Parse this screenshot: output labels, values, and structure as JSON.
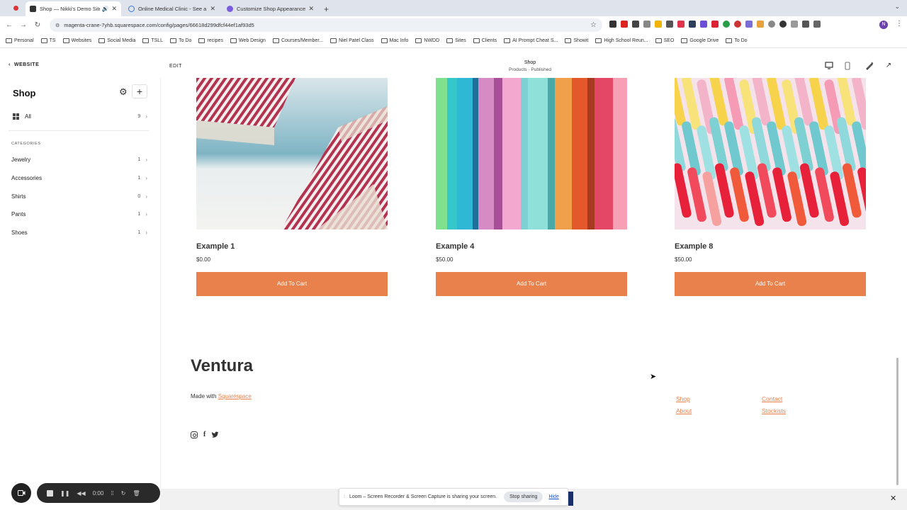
{
  "browser": {
    "tabs": [
      {
        "title": "Shop — Nikki's Demo Site",
        "active": true
      },
      {
        "title": "Online Medical Clinic - See a",
        "active": false
      },
      {
        "title": "Customize Shop Appearance",
        "active": false
      }
    ],
    "url": "magenta-crane-7yhb.squarespace.com/config/pages/66618d299dfcf44ef1af93d5",
    "profile_initial": "N",
    "bookmarks": [
      "Personal",
      "TS",
      "Websites",
      "Social Media",
      "TSLL",
      "To Do",
      "recipes",
      "Web Design",
      "Courses/Member...",
      "Niel Patel Class",
      "Mac Info",
      "NWDD",
      "Sites",
      "Clients",
      "AI Prompt Cheat S...",
      "Showit",
      "High School Reun...",
      "SEO",
      "Google Drive",
      "To Do"
    ]
  },
  "sidebar": {
    "back_label": "WEBSITE",
    "title": "Shop",
    "all": {
      "label": "All",
      "count": "9"
    },
    "categories_heading": "CATEGORIES",
    "categories": [
      {
        "label": "Jewelry",
        "count": "1"
      },
      {
        "label": "Accessories",
        "count": "1"
      },
      {
        "label": "Shirts",
        "count": "0"
      },
      {
        "label": "Pants",
        "count": "1"
      },
      {
        "label": "Shoes",
        "count": "1"
      }
    ]
  },
  "editor": {
    "edit_label": "EDIT",
    "page_name": "Shop",
    "page_status": "Products · Published"
  },
  "products": [
    {
      "name": "Example 1",
      "price": "$0.00",
      "button": "Add To Cart"
    },
    {
      "name": "Example 4",
      "price": "$50.00",
      "button": "Add To Cart"
    },
    {
      "name": "Example 8",
      "price": "$50.00",
      "button": "Add To Cart"
    }
  ],
  "footer": {
    "brand": "Ventura",
    "made_with": "Made with ",
    "made_link": "Squarespace",
    "links_col1": [
      "Shop",
      "About"
    ],
    "links_col2": [
      "Contact",
      "Stockists"
    ]
  },
  "recorder": {
    "time": "0:00"
  },
  "loom": {
    "message": "Loom – Screen Recorder & Screen Capture is sharing your screen.",
    "stop_label": "Stop sharing",
    "hide_label": "Hide"
  },
  "colors": {
    "accent": "#e8814c"
  }
}
